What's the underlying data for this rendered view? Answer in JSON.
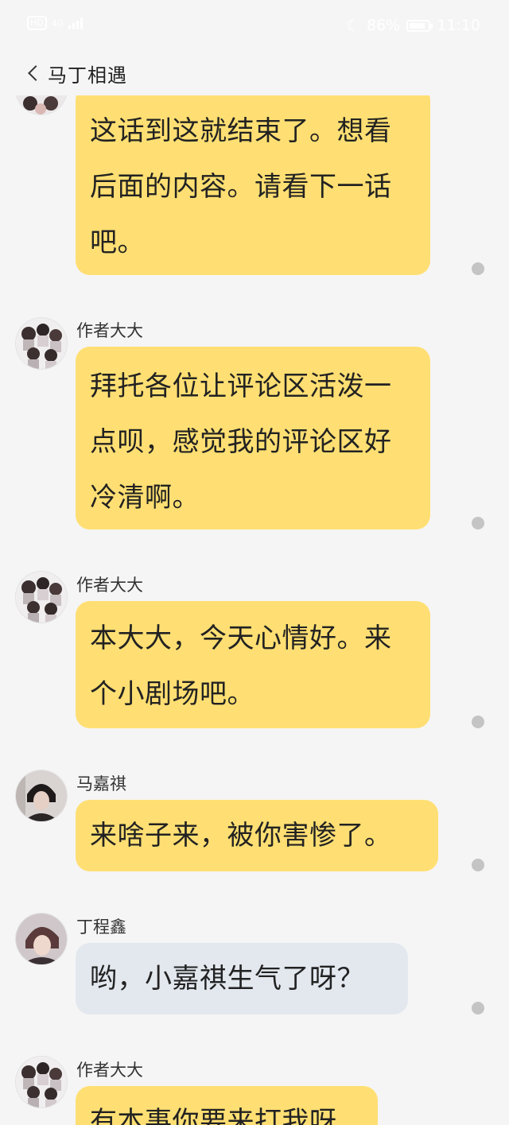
{
  "status_bar": {
    "network_type": "4G",
    "battery_percent": "86%",
    "time": "11:10",
    "battery_level": 0.86,
    "icons": [
      "hd-icon",
      "signal-icon",
      "moon-icon",
      "battery-icon"
    ]
  },
  "header": {
    "title": "马丁相遇"
  },
  "messages": [
    {
      "sender": "",
      "text": "这话到这就结束了。想看后面的内容。请看下一话吧。",
      "bubble_color": "#ffdf73"
    },
    {
      "sender": "作者大大",
      "text": "拜托各位让评论区活泼一点呗，感觉我的评论区好冷清啊。",
      "bubble_color": "#ffdf73"
    },
    {
      "sender": "作者大大",
      "text": "本大大，今天心情好。来个小剧场吧。",
      "bubble_color": "#ffdf73"
    },
    {
      "sender": "马嘉祺",
      "text": "来啥子来，被你害惨了。",
      "bubble_color": "#ffdf73"
    },
    {
      "sender": "丁程鑫",
      "text": "哟，小嘉祺生气了呀？",
      "bubble_color": "#e3e8ef"
    },
    {
      "sender": "作者大大",
      "text": "有本事你要来打我呀",
      "bubble_color": "#ffdf73"
    }
  ]
}
